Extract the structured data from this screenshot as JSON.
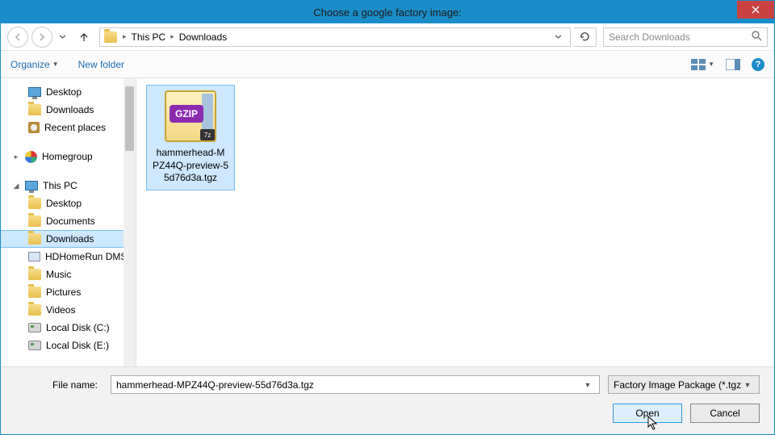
{
  "title": "Choose a google factory image:",
  "breadcrumb": {
    "loc1": "This PC",
    "loc2": "Downloads"
  },
  "search": {
    "placeholder": "Search Downloads"
  },
  "toolbar": {
    "organize": "Organize",
    "newfolder": "New folder"
  },
  "sidebar": {
    "desktop": "Desktop",
    "downloads": "Downloads",
    "recent": "Recent places",
    "homegroup": "Homegroup",
    "thispc": "This PC",
    "pc_desktop": "Desktop",
    "pc_documents": "Documents",
    "pc_downloads": "Downloads",
    "pc_hdhomerun": "HDHomeRun DMS",
    "pc_music": "Music",
    "pc_pictures": "Pictures",
    "pc_videos": "Videos",
    "pc_diskc": "Local Disk (C:)",
    "pc_diske": "Local Disk (E:)"
  },
  "file": {
    "name_line1": "hammerhead-M",
    "name_line2": "PZ44Q-preview-5",
    "name_line3": "5d76d3a.tgz",
    "badge": "GZIP",
    "mini": "7z"
  },
  "filename": {
    "label": "File name:",
    "value": "hammerhead-MPZ44Q-preview-55d76d3a.tgz"
  },
  "filter": "Factory Image Package (*.tgz;*.",
  "buttons": {
    "open": "Open",
    "cancel": "Cancel"
  }
}
